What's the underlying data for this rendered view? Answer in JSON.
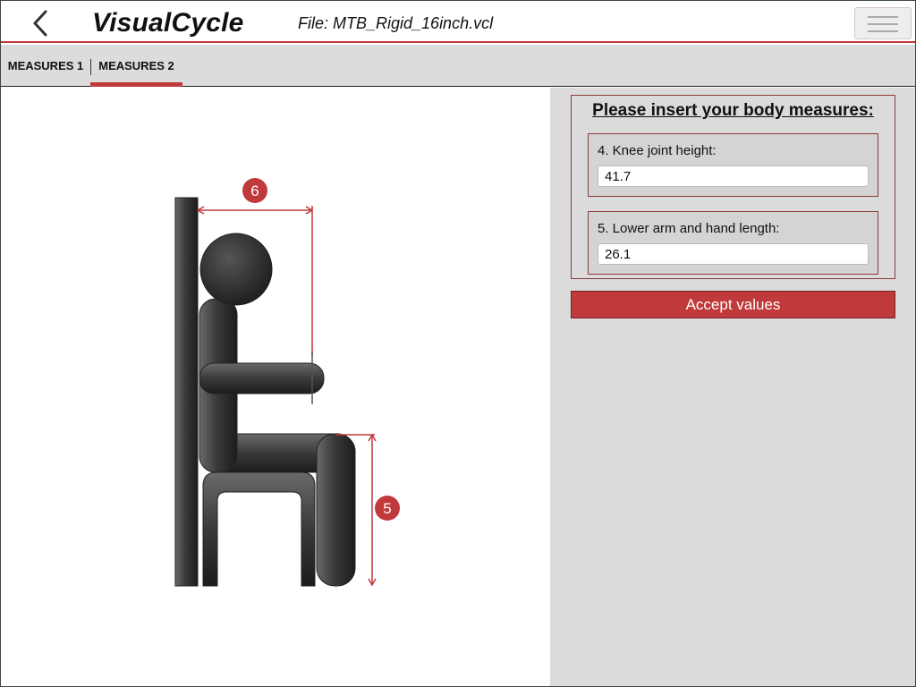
{
  "header": {
    "app_title": "VisualCycle",
    "file_label": "File: MTB_Rigid_16inch.vcl"
  },
  "tabs": [
    {
      "label": "MEASURES 1",
      "active": false
    },
    {
      "label": "MEASURES 2",
      "active": true
    }
  ],
  "illustration": {
    "markers": [
      {
        "number": "6",
        "meaning": "lower arm and hand length"
      },
      {
        "number": "5",
        "meaning": "knee joint height"
      }
    ]
  },
  "measures": {
    "title": "Please insert your body measures:",
    "fields": [
      {
        "label": "4. Knee joint height:",
        "value": "41.7"
      },
      {
        "label": "5. Lower arm and hand length:",
        "value": "26.1"
      }
    ],
    "accept_label": "Accept values"
  },
  "colors": {
    "accent": "#c0393b",
    "panel_bg": "#dbdbdb"
  }
}
